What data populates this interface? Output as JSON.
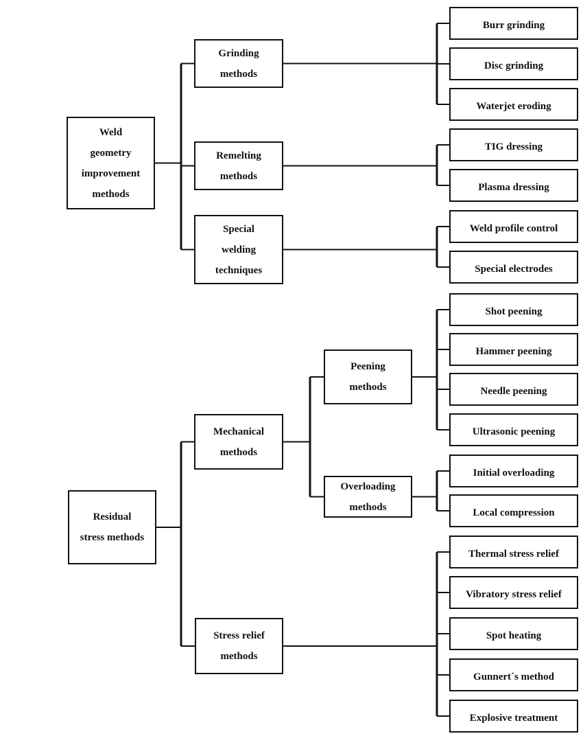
{
  "diagram": {
    "colors": {
      "line": "#111111",
      "box_fill": "#ffffff",
      "text": "#111111"
    },
    "trees": [
      {
        "root": {
          "id": "weld",
          "lines": [
            "Weld",
            "geometry",
            "improvement",
            "methods"
          ]
        },
        "children": [
          {
            "id": "grinding",
            "lines": [
              "Grinding",
              "methods"
            ],
            "leaves": [
              "Burr grinding",
              "Disc grinding",
              "Waterjet eroding"
            ]
          },
          {
            "id": "remelting",
            "lines": [
              "Remelting",
              "methods"
            ],
            "leaves": [
              "TIG dressing",
              "Plasma dressing"
            ]
          },
          {
            "id": "special",
            "lines": [
              "Special",
              "welding",
              "techniques"
            ],
            "leaves": [
              "Weld profile control",
              "Special electrodes"
            ]
          }
        ]
      },
      {
        "root": {
          "id": "residual",
          "lines": [
            "Residual",
            "stress methods"
          ]
        },
        "children": [
          {
            "id": "mechanical",
            "lines": [
              "Mechanical",
              "methods"
            ],
            "children": [
              {
                "id": "peening",
                "lines": [
                  "Peening",
                  "methods"
                ],
                "leaves": [
                  "Shot peening",
                  "Hammer peening",
                  "Needle peening",
                  "Ultrasonic peening"
                ]
              },
              {
                "id": "overloading",
                "lines": [
                  "Overloading",
                  "methods"
                ],
                "leaves": [
                  "Initial overloading",
                  "Local compression"
                ]
              }
            ]
          },
          {
            "id": "stressrelief",
            "lines": [
              "Stress relief",
              "methods"
            ],
            "leaves": [
              "Thermal stress relief",
              "Vibratory stress relief",
              "Spot heating",
              "Gunnert´s method",
              "Explosive treatment"
            ]
          }
        ]
      }
    ]
  }
}
